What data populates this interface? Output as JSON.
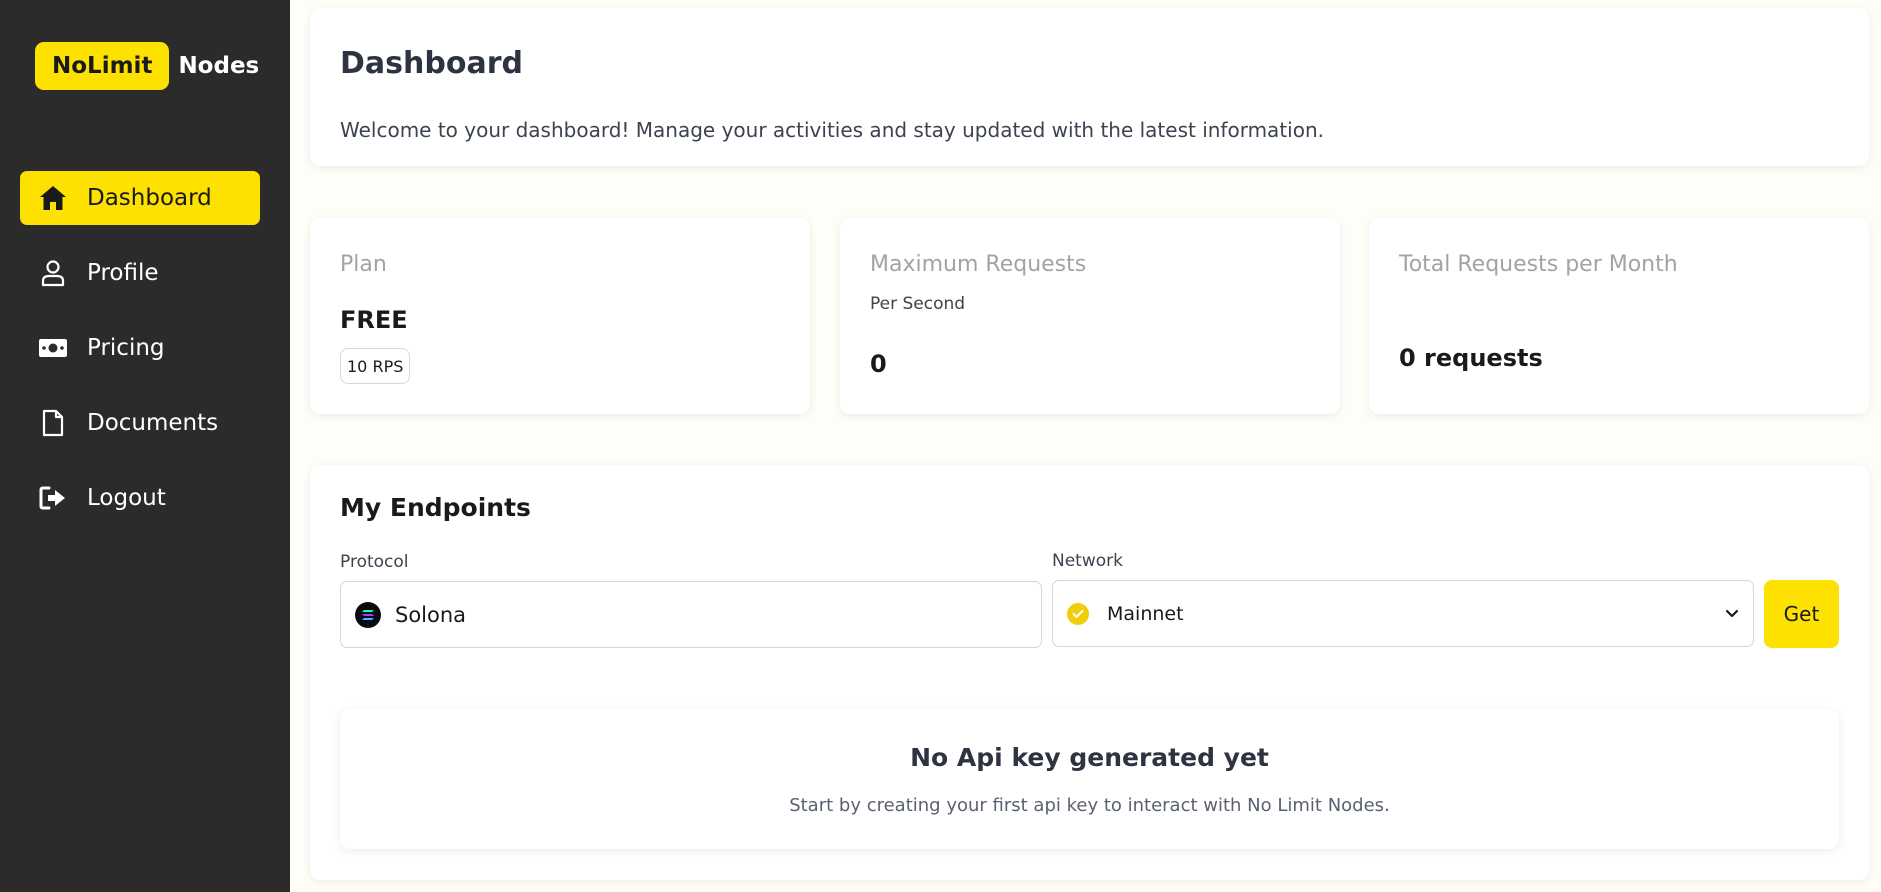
{
  "brand": {
    "badge": "NoLimit",
    "name": "Nodes",
    "accent": "#fde100"
  },
  "sidebar": {
    "items": [
      {
        "label": "Dashboard",
        "icon": "home-icon",
        "active": true
      },
      {
        "label": "Profile",
        "icon": "user-icon",
        "active": false
      },
      {
        "label": "Pricing",
        "icon": "money-icon",
        "active": false
      },
      {
        "label": "Documents",
        "icon": "document-icon",
        "active": false
      },
      {
        "label": "Logout",
        "icon": "logout-icon",
        "active": false
      }
    ]
  },
  "header": {
    "title": "Dashboard",
    "subtitle": "Welcome to your dashboard! Manage your activities and stay updated with the latest information."
  },
  "stats": {
    "plan": {
      "title": "Plan",
      "value": "FREE",
      "badge": "10 RPS"
    },
    "max_requests": {
      "title": "Maximum Requests",
      "subtitle": "Per Second",
      "value": "0"
    },
    "total_requests": {
      "title": "Total Requests per Month",
      "value": "0 requests"
    }
  },
  "endpoints": {
    "title": "My Endpoints",
    "protocol_label": "Protocol",
    "protocol_value": "Solona",
    "network_label": "Network",
    "network_value": "Mainnet",
    "get_label": "Get",
    "empty_title": "No Api key generated yet",
    "empty_desc": "Start by creating your first api key to interact with No Limit Nodes."
  }
}
